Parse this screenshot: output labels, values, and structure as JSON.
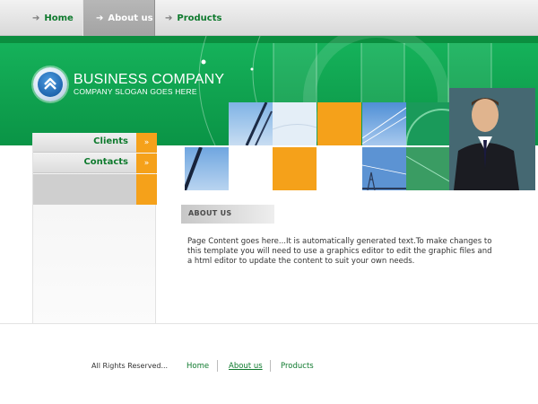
{
  "top_nav": {
    "items": [
      {
        "label": "Home",
        "active": false
      },
      {
        "label": "About us",
        "active": true
      },
      {
        "label": "Products",
        "active": false
      }
    ]
  },
  "header": {
    "company_name": "BUSINESS COMPANY",
    "slogan": "COMPANY SLOGAN GOES HERE",
    "logo_icon": "double-chevron-up-icon"
  },
  "sidebar": {
    "items": [
      {
        "label": "Clients"
      },
      {
        "label": "Contacts"
      }
    ]
  },
  "content": {
    "section_title": "ABOUT US",
    "body": "Page Content goes here...It is automatically generated text.To make changes to this template you will need to use a graphics editor to edit the graphic files and a html editor to update the content to suit your own needs."
  },
  "footer": {
    "copyright": "All Rights Reserved...",
    "links": [
      {
        "label": "Home",
        "active": false
      },
      {
        "label": "About us",
        "active": true
      },
      {
        "label": "Products",
        "active": false
      }
    ]
  },
  "colors": {
    "brand_green": "#0fa04e",
    "accent_orange": "#f5a11a",
    "link_green": "#0f7a2e"
  }
}
